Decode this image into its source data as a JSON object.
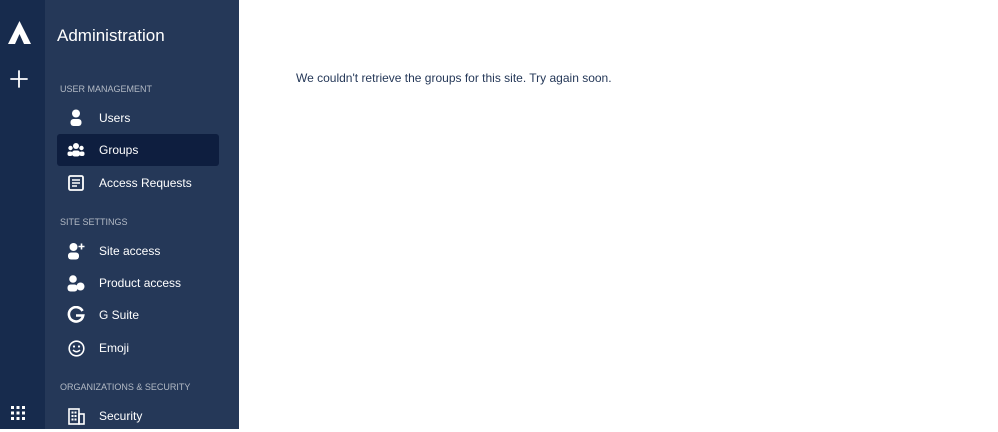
{
  "global_nav": {
    "logo_icon": "atlassian-logo-icon",
    "create_icon": "plus-icon",
    "app_switcher_icon": "app-grid-icon",
    "background_color": "#172b4d"
  },
  "sidebar": {
    "title": "Administration",
    "background_color": "#253858",
    "active_color": "#0e1e3f",
    "sections": [
      {
        "label": "USER MANAGEMENT",
        "items": [
          {
            "label": "Users",
            "icon": "person-icon",
            "active": false
          },
          {
            "label": "Groups",
            "icon": "people-group-icon",
            "active": true
          },
          {
            "label": "Access Requests",
            "icon": "document-icon",
            "active": false
          }
        ]
      },
      {
        "label": "SITE SETTINGS",
        "items": [
          {
            "label": "Site access",
            "icon": "person-add-icon",
            "active": false
          },
          {
            "label": "Product access",
            "icon": "person-product-icon",
            "active": false
          },
          {
            "label": "G Suite",
            "icon": "google-icon",
            "active": false
          },
          {
            "label": "Emoji",
            "icon": "emoji-icon",
            "active": false
          }
        ]
      },
      {
        "label": "ORGANIZATIONS & SECURITY",
        "items": [
          {
            "label": "Security",
            "icon": "building-icon",
            "active": false
          }
        ]
      }
    ]
  },
  "main": {
    "message": "We couldn't retrieve the groups for this site. Try again soon.",
    "text_color": "#253858"
  }
}
